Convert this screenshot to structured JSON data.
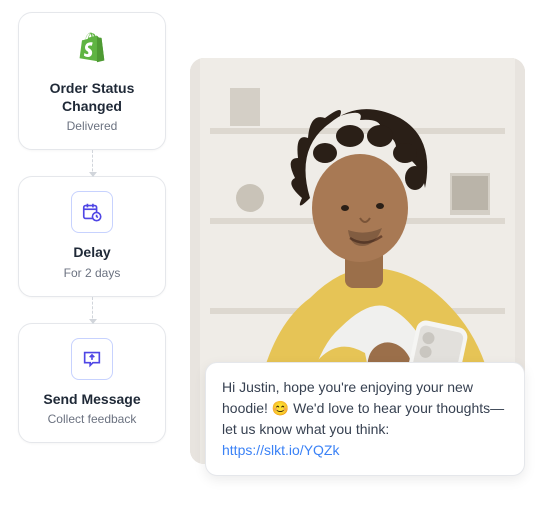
{
  "flow": [
    {
      "icon": "shopify",
      "title": "Order Status Changed",
      "subtitle": "Delivered"
    },
    {
      "icon": "calendar-clock",
      "title": "Delay",
      "subtitle": "For 2 days"
    },
    {
      "icon": "chat-upload",
      "title": "Send Message",
      "subtitle": "Collect feedback"
    }
  ],
  "message": {
    "greeting": "Hi Justin, hope you're enjoying your new hoodie! ",
    "emoji": "😊",
    "body": " We'd love to hear your thoughts—let us know what you think: ",
    "link_text": "https://slkt.io/YQZk",
    "link_href": "https://slkt.io/YQZk"
  },
  "colors": {
    "shopify": "#5fb442",
    "accent": "#4f46e5",
    "link": "#3b82f6"
  }
}
